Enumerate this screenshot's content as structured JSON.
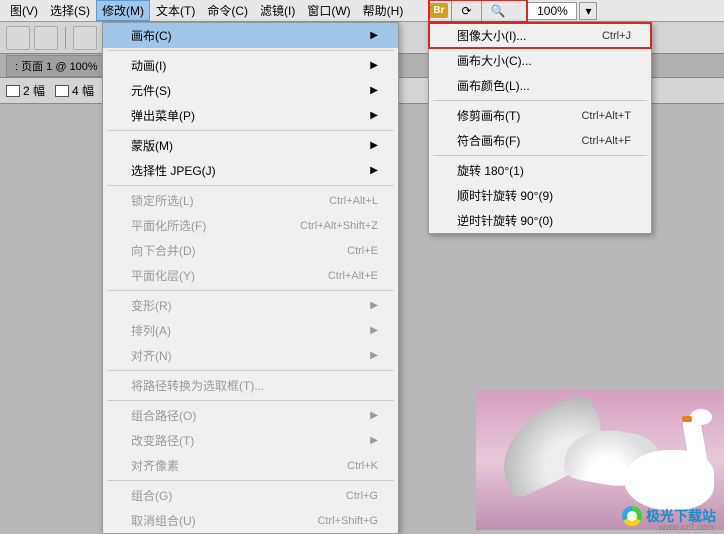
{
  "menubar": {
    "items": [
      {
        "label": "图(V)"
      },
      {
        "label": "选择(S)"
      },
      {
        "label": "修改(M)",
        "active": true
      },
      {
        "label": "文本(T)"
      },
      {
        "label": "命令(C)"
      },
      {
        "label": "滤镜(I)"
      },
      {
        "label": "窗口(W)"
      },
      {
        "label": "帮助(H)"
      }
    ]
  },
  "toolbar": {
    "br_label": "Br",
    "zoom": "100%"
  },
  "tab": {
    "label": ": 页面 1 @ 100%"
  },
  "aux": {
    "item1": "2 幅",
    "item2": "4 幅"
  },
  "dropdown_main": [
    {
      "label": "画布(C)",
      "arrow": true,
      "highlighted": true
    },
    {
      "sep": true
    },
    {
      "label": "动画(I)",
      "arrow": true
    },
    {
      "label": "元件(S)",
      "arrow": true
    },
    {
      "label": "弹出菜单(P)",
      "arrow": true
    },
    {
      "sep": true
    },
    {
      "label": "蒙版(M)",
      "arrow": true
    },
    {
      "label": "选择性 JPEG(J)",
      "arrow": true
    },
    {
      "sep": true
    },
    {
      "label": "锁定所选(L)",
      "shortcut": "Ctrl+Alt+L",
      "disabled": true
    },
    {
      "label": "平面化所选(F)",
      "shortcut": "Ctrl+Alt+Shift+Z",
      "disabled": true
    },
    {
      "label": "向下合并(D)",
      "shortcut": "Ctrl+E",
      "disabled": true
    },
    {
      "label": "平面化层(Y)",
      "shortcut": "Ctrl+Alt+E",
      "disabled": true
    },
    {
      "sep": true
    },
    {
      "label": "变形(R)",
      "arrow": true,
      "disabled": true
    },
    {
      "label": "排列(A)",
      "arrow": true,
      "disabled": true
    },
    {
      "label": "对齐(N)",
      "arrow": true,
      "disabled": true
    },
    {
      "sep": true
    },
    {
      "label": "将路径转换为选取框(T)...",
      "disabled": true
    },
    {
      "sep": true
    },
    {
      "label": "组合路径(O)",
      "arrow": true,
      "disabled": true
    },
    {
      "label": "改变路径(T)",
      "arrow": true,
      "disabled": true
    },
    {
      "label": "对齐像素",
      "shortcut": "Ctrl+K",
      "disabled": true
    },
    {
      "sep": true
    },
    {
      "label": "组合(G)",
      "shortcut": "Ctrl+G",
      "disabled": true
    },
    {
      "label": "取消组合(U)",
      "shortcut": "Ctrl+Shift+G",
      "disabled": true
    }
  ],
  "dropdown_sub": [
    {
      "label": "图像大小(I)...",
      "shortcut": "Ctrl+J",
      "boxed": true
    },
    {
      "label": "画布大小(C)..."
    },
    {
      "label": "画布颜色(L)..."
    },
    {
      "sep": true
    },
    {
      "label": "修剪画布(T)",
      "shortcut": "Ctrl+Alt+T"
    },
    {
      "label": "符合画布(F)",
      "shortcut": "Ctrl+Alt+F"
    },
    {
      "sep": true
    },
    {
      "label": "旋转 180°(1)"
    },
    {
      "label": "顺时针旋转 90°(9)"
    },
    {
      "label": "逆时针旋转 90°(0)"
    }
  ],
  "watermark": {
    "text": "极光下载站",
    "sub": "www.xz7.com"
  }
}
